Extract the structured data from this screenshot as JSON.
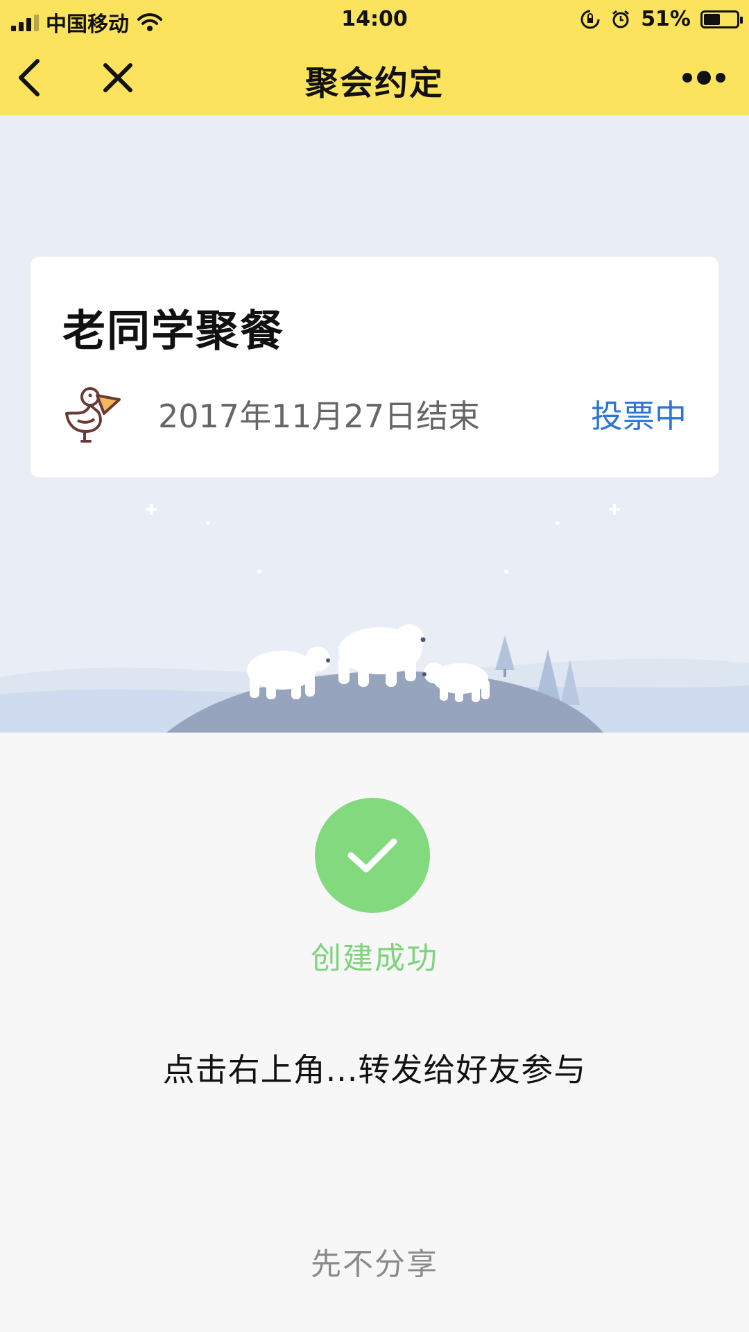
{
  "status_bar": {
    "carrier": "中国移动",
    "time": "14:00",
    "battery": "51%",
    "battery_level": 0.51
  },
  "nav": {
    "title": "聚会约定",
    "back_icon": "chevron-left-icon",
    "close_icon": "close-icon",
    "more_icon": "more-dots-icon"
  },
  "card": {
    "name": "老同学聚餐",
    "end_date": "2017年11月27日结束",
    "status": "投票中",
    "avatar_icon": "pelican-icon"
  },
  "result": {
    "success_text": "创建成功",
    "instruction": "点击右上角...转发给好友参与",
    "skip_label": "先不分享"
  },
  "colors": {
    "header": "#fbe35d",
    "success": "#82d97e",
    "status_tag": "#2a76d8",
    "scene_bg": "#e9edf5"
  }
}
